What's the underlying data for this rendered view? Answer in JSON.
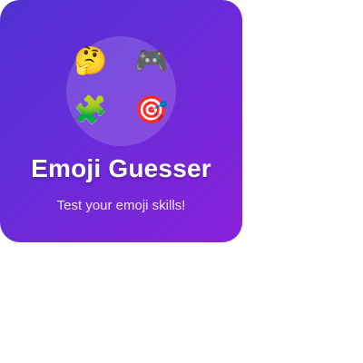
{
  "card": {
    "title": "Emoji Guesser",
    "subtitle": "Test your emoji skills!",
    "emojis": [
      {
        "glyph": "🤔",
        "name": "thinking-face"
      },
      {
        "glyph": "🎮",
        "name": "video-game-controller"
      },
      {
        "glyph": "🧩",
        "name": "puzzle-piece"
      },
      {
        "glyph": "🎯",
        "name": "direct-hit-target"
      }
    ]
  },
  "colors": {
    "gradient_start": "#4f32d0",
    "gradient_end": "#8a22d8",
    "text": "#ffffff"
  }
}
